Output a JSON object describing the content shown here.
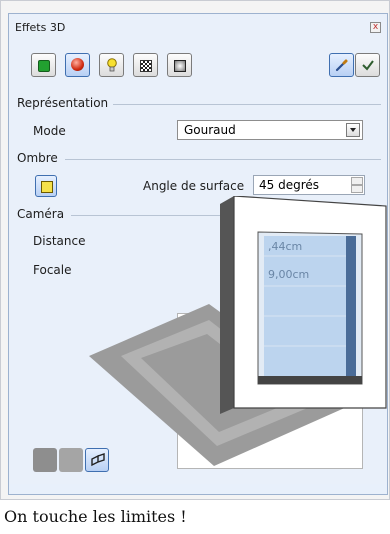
{
  "panel": {
    "title": "Effets 3D",
    "close_label": "x"
  },
  "toolbar": {
    "buttons": [
      {
        "name": "geometry-button",
        "icon": "green-cube-icon"
      },
      {
        "name": "shading-button",
        "icon": "red-sphere-icon"
      },
      {
        "name": "illumination-button",
        "icon": "lightbulb-icon"
      },
      {
        "name": "textures-button",
        "icon": "checker-texture-icon"
      },
      {
        "name": "material-button",
        "icon": "material-square-icon"
      },
      {
        "name": "assign-button",
        "icon": "pipette-icon"
      },
      {
        "name": "update-button",
        "icon": "checkmark-icon"
      }
    ]
  },
  "representation": {
    "section": "Représentation",
    "mode_label": "Mode",
    "mode_value": "Gouraud"
  },
  "shadow": {
    "section": "Ombre",
    "angle_label": "Angle de surface",
    "angle_value": "45 degrés"
  },
  "camera": {
    "section": "Caméra",
    "distance_label": "Distance",
    "distance_value": ",44cm",
    "focal_label": "Focale",
    "focal_value": "9,00cm"
  },
  "status_text": "On touche les limites !",
  "colors": {
    "panel_bg": "#e9f0fa",
    "accent": "#3f6fb0",
    "shadow": "#9a9a9a"
  }
}
